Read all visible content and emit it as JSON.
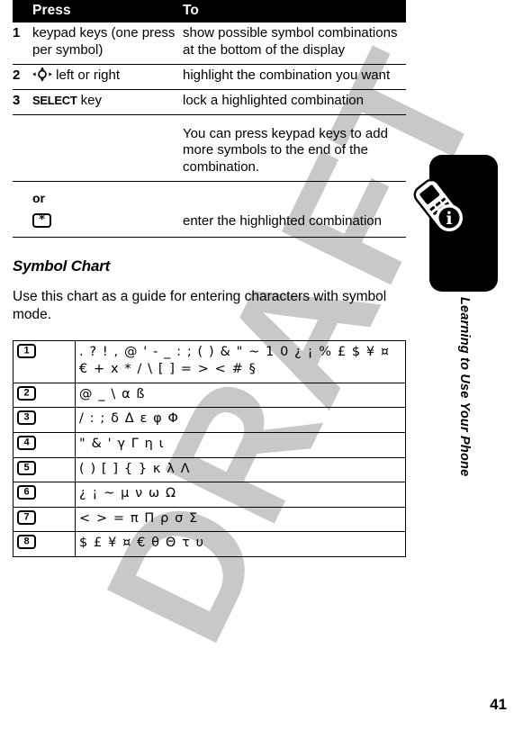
{
  "page": {
    "number": "41",
    "watermark": "DRAFT",
    "sidebar_label": "Learning to Use Your Phone",
    "sidebar_icon": "phone-info-icon"
  },
  "steps_table": {
    "headers": {
      "num": "",
      "press": "Press",
      "to": "To"
    },
    "rows": [
      {
        "num": "1",
        "press": "keypad keys (one press per symbol)",
        "press_icon": "",
        "to": "show possible symbol combinations at the bottom of the display"
      },
      {
        "num": "2",
        "press": "left or right",
        "press_icon": "nav-key-icon",
        "to": "highlight the combination you want"
      },
      {
        "num": "3",
        "press_strong": "SELECT",
        "press": "key",
        "press_icon": "",
        "to": "lock a highlighted combination",
        "to_note": "You can press keypad keys to add more symbols to the end of the combination.",
        "or_label": "or",
        "alt_press_icon": "star-key-icon",
        "alt_press_key": "*",
        "alt_to": "enter the highlighted combination"
      }
    ]
  },
  "symbol_section": {
    "heading": "Symbol Chart",
    "intro": "Use this chart as a guide for entering characters with symbol mode.",
    "rows": [
      {
        "key": "1",
        "symbols": ". ? ! , @ ' - _ : ; ( ) & \" ~ 1 0 ¿ ¡ % £ $ ¥ ¤ €  + x * / \\ [ ] = > < # §"
      },
      {
        "key": "2",
        "symbols": "@ _ \\ α ß"
      },
      {
        "key": "3",
        "symbols": "/ : ; δ Δ ε φ Φ"
      },
      {
        "key": "4",
        "symbols": "\" & ' γ Γ η ι"
      },
      {
        "key": "5",
        "symbols": "( ) [ ] { } κ λ Λ"
      },
      {
        "key": "6",
        "symbols": "¿ ¡ ~ μ ν ω Ω"
      },
      {
        "key": "7",
        "symbols": "< > = π Π ρ σ Σ"
      },
      {
        "key": "8",
        "symbols": "$ £ ¥ ¤ € θ Θ τ υ"
      }
    ]
  }
}
